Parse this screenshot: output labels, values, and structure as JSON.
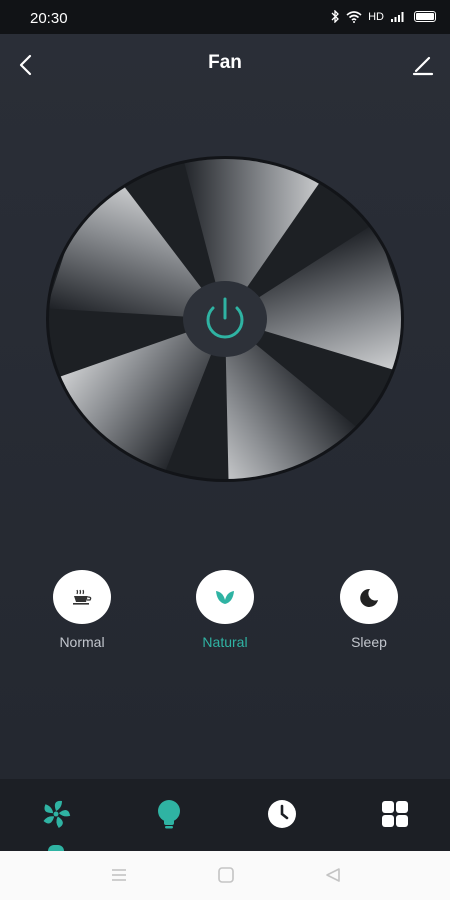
{
  "status": {
    "time": "20:30",
    "hd": "HD",
    "icons": [
      "bluetooth-icon",
      "wifi-icon",
      "signal-icon",
      "battery-icon"
    ]
  },
  "header": {
    "title": "Fan",
    "back_icon": "chevron-left-icon",
    "edit_icon": "pencil-icon"
  },
  "fan": {
    "power_icon": "power-icon",
    "accent": "#2fb3a3"
  },
  "modes": [
    {
      "label": "Normal",
      "icon": "coffee-cup-icon",
      "active": false
    },
    {
      "label": "Natural",
      "icon": "leaf-icon",
      "active": true
    },
    {
      "label": "Sleep",
      "icon": "moon-icon",
      "active": false
    }
  ],
  "tabs": [
    {
      "icon": "fan-icon",
      "active": true
    },
    {
      "icon": "bulb-icon",
      "active": false
    },
    {
      "icon": "clock-icon",
      "active": false
    },
    {
      "icon": "grid-icon",
      "active": false
    }
  ],
  "nav": [
    "menu-icon",
    "home-square-icon",
    "back-triangle-icon"
  ]
}
